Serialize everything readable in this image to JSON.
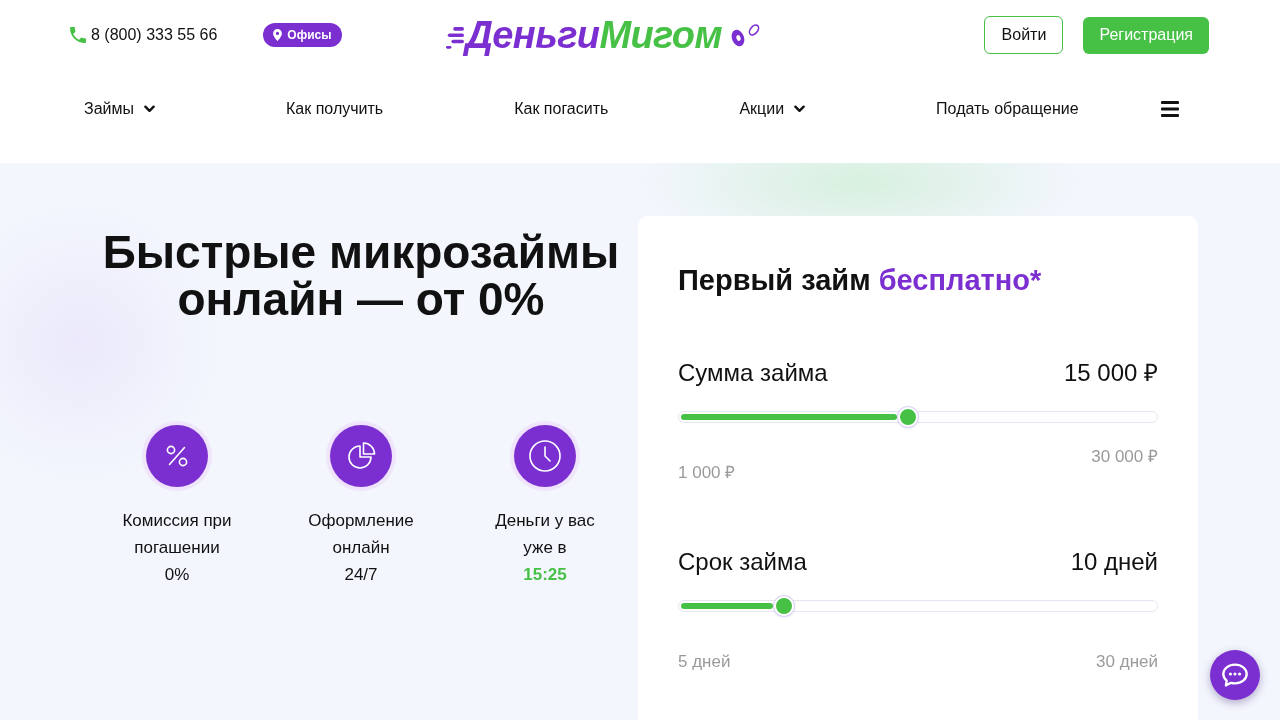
{
  "header": {
    "phone": "8 (800) 333 55 66",
    "offices_button": "Офисы",
    "logo": {
      "part_1": "Деньги",
      "part_2": "Мигом"
    },
    "buttons": [
      {
        "label": "Войти",
        "kind": "outline"
      },
      {
        "label": "Регистрация",
        "kind": "primary"
      }
    ]
  },
  "nav": {
    "items": [
      {
        "label": "Займы",
        "dropdown": true
      },
      {
        "label": "Как получить",
        "dropdown": false
      },
      {
        "label": "Как погасить",
        "dropdown": false
      },
      {
        "label": "Акции",
        "dropdown": true
      },
      {
        "label": "Подать обращение",
        "dropdown": false
      }
    ]
  },
  "hero": {
    "title": "Быстрые микрозаймы онлайн — от 0%",
    "features": [
      {
        "kind": "percent",
        "label": "Комиссия при погашении",
        "value": "0%",
        "highlighted": false
      },
      {
        "kind": "chart",
        "label": "Оформление онлайн",
        "value": "24/7",
        "highlighted": false
      },
      {
        "kind": "clock",
        "label": "Деньги у вас уже в",
        "value": "15:25",
        "highlighted": true
      }
    ]
  },
  "calculator": {
    "title": "Первый займ",
    "title_accent": "бесплатно*",
    "sliders": [
      {
        "label": "Сумма займа",
        "value": "15 000 ₽",
        "level": 0.48,
        "min": "1 000 ₽",
        "max": "30 000 ₽"
      },
      {
        "label": "Срок займа",
        "value": "10 дней",
        "level": 0.22,
        "min": "5 дней",
        "max": "30 дней"
      }
    ]
  }
}
